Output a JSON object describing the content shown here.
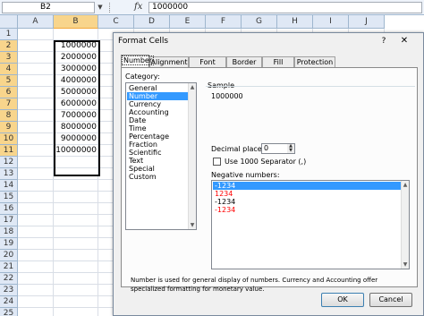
{
  "formula_bar": {
    "name_box": "B2",
    "fx_label": "fx",
    "formula_value": "1000000"
  },
  "sheet": {
    "columns": [
      "A",
      "B",
      "C",
      "D",
      "E",
      "F",
      "G",
      "H",
      "I",
      "J"
    ],
    "active_column": "B",
    "rows": [
      "1",
      "2",
      "3",
      "4",
      "5",
      "6",
      "7",
      "8",
      "9",
      "10",
      "11",
      "12",
      "13",
      "14",
      "15",
      "16",
      "17",
      "18",
      "19",
      "20",
      "21",
      "22",
      "23",
      "24",
      "25"
    ],
    "column_b_values": [
      "1000000",
      "2000000",
      "3000000",
      "4000000",
      "5000000",
      "6000000",
      "7000000",
      "8000000",
      "9000000",
      "10000000"
    ]
  },
  "dialog": {
    "title": "Format Cells",
    "help": "?",
    "close": "✕",
    "tabs": [
      {
        "label": "Number"
      },
      {
        "label": "Alignment"
      },
      {
        "label": "Font"
      },
      {
        "label": "Border"
      },
      {
        "label": "Fill"
      },
      {
        "label": "Protection"
      }
    ],
    "category_label": "Category:",
    "categories": [
      "General",
      "Number",
      "Currency",
      "Accounting",
      "Date",
      "Time",
      "Percentage",
      "Fraction",
      "Scientific",
      "Text",
      "Special",
      "Custom"
    ],
    "selected_category": "Number",
    "sample_label": "Sample",
    "sample_value": "1000000",
    "decimal_label": "Decimal places:",
    "decimal_value": "0",
    "separator_label": "Use 1000 Separator (,)",
    "separator_checked": false,
    "negative_label": "Negative numbers:",
    "negative_options": [
      {
        "text": "-1234",
        "color": "#000000"
      },
      {
        "text": "1234",
        "color": "#ff0000"
      },
      {
        "text": "-1234",
        "color": "#000000"
      },
      {
        "text": "-1234",
        "color": "#ff0000"
      }
    ],
    "description": "Number is used for general display of numbers.  Currency and Accounting offer specialized formatting for monetary value.",
    "ok_label": "OK",
    "cancel_label": "Cancel"
  }
}
